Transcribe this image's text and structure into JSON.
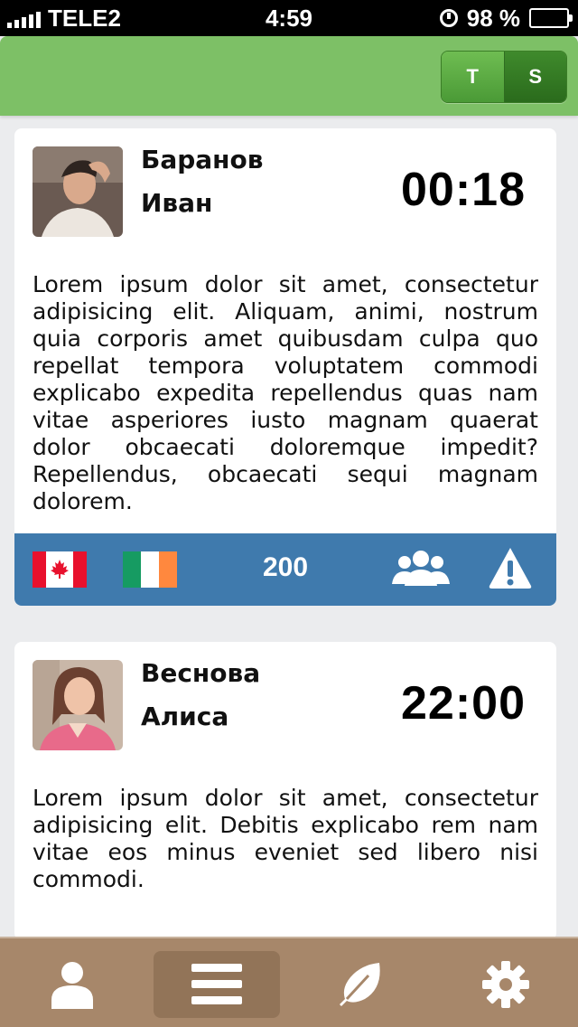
{
  "status_bar": {
    "carrier": "TELE2",
    "time": "4:59",
    "battery": "98 %",
    "battery_level": 0.98
  },
  "header": {
    "toggle": {
      "t_label": "T",
      "s_label": "S"
    }
  },
  "cards": [
    {
      "name_line1": "Баранов",
      "name_line2": "Иван",
      "time": "00:18",
      "text": "Lorem ipsum dolor sit amet, consectetur adipisicing elit. Aliquam, animi, nostrum quia corporis amet quibusdam culpa quo repellat tempora voluptatem commodi explicabo expedita repellendus quas nam vitae asperiores iusto magnam quaerat dolor obcaecati doloremque impedit? Repellendus, obcaecati sequi magnam dolorem.",
      "footer": {
        "flags": [
          "canada-flag-icon",
          "ireland-flag-icon"
        ],
        "count": "200"
      }
    },
    {
      "name_line1": "Веснова",
      "name_line2": "Алиса",
      "time": "22:00",
      "text": "Lorem ipsum dolor sit amet, consectetur adipisicing elit. Debitis explicabo rem nam vitae eos minus eveniet sed libero nisi commodi."
    }
  ],
  "tab_bar": {
    "tabs": [
      {
        "icon": "user-icon",
        "active": false
      },
      {
        "icon": "menu-icon",
        "active": true
      },
      {
        "icon": "leaf-icon",
        "active": false
      },
      {
        "icon": "gear-icon",
        "active": false
      }
    ]
  },
  "colors": {
    "header_green": "#7dc066",
    "footer_blue": "#3f7aad",
    "tab_bar_brown": "#a7876a"
  }
}
